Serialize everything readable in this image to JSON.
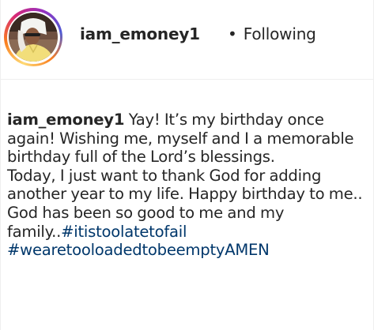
{
  "post": {
    "username": "iam_emoney1",
    "separator": "•",
    "follow_status": "Following",
    "caption": {
      "username": "iam_emoney1",
      "text_part1": "Yay! It’s my birthday once again! Wishing me, myself and I a memorable birthday full of the Lord’s blessings.",
      "text_part2": "Today, I just want to thank God for adding another year to my life. Happy birthday to me.. God has been so good to me and my family..",
      "hashtags": [
        "#itistoolatetofail",
        "#wearetooloadedtobeemptyAMEN"
      ]
    }
  },
  "colors": {
    "text": "#262626",
    "hashtag": "#00376b",
    "divider": "#efefef"
  }
}
